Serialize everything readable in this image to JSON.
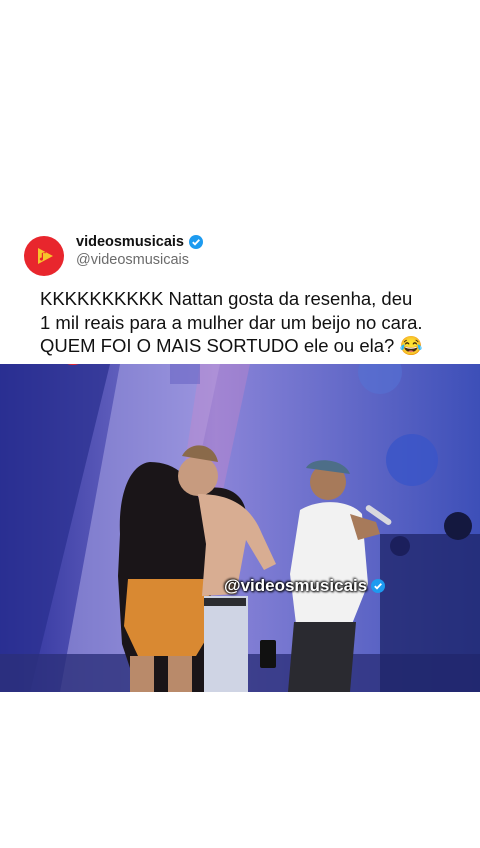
{
  "post": {
    "display_name": "videosmusicais",
    "handle": "@videosmusicais",
    "text_lines": [
      "KKKKKKKKKK Nattan gosta da resenha, deu",
      "1 mil reais para a mulher dar um beijo no cara.",
      "QUEM FOI O MAIS SORTUDO ele ou ela? 😂"
    ],
    "verified": true
  },
  "media": {
    "watermark": "@videosmusicais"
  },
  "colors": {
    "brand_red": "#e8262d",
    "verified_blue": "#1d9bf0",
    "stage_blue": "#3a3aa8"
  }
}
